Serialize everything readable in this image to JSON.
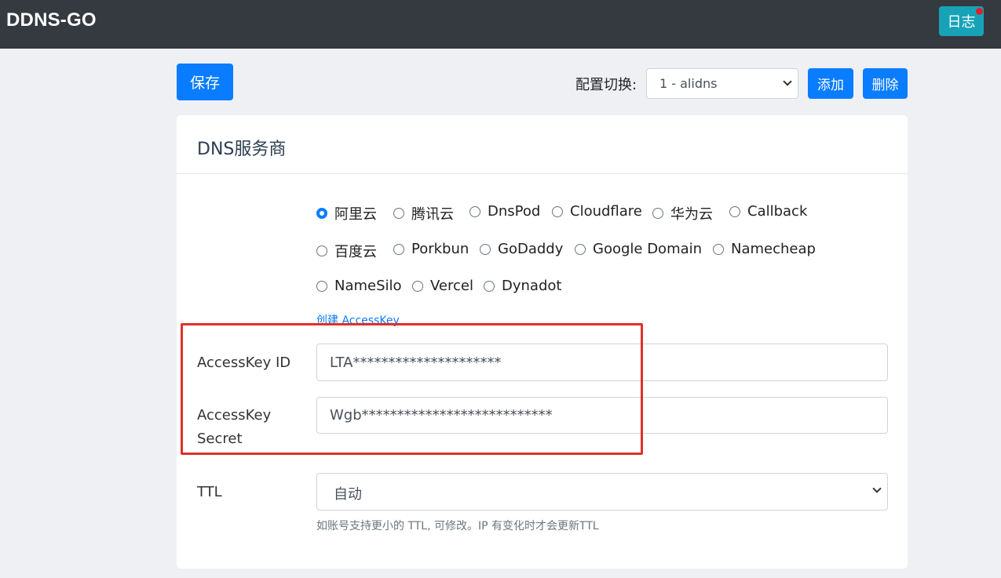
{
  "navbar": {
    "brand": "DDNS-GO",
    "log_button": "日志"
  },
  "toolbar": {
    "save_label": "保存",
    "config_switch_label": "配置切换:",
    "config_selected": "1 - alidns",
    "add_label": "添加",
    "delete_label": "删除"
  },
  "card": {
    "title": "DNS服务商",
    "providers": [
      "阿里云",
      "腾讯云",
      "DnsPod",
      "Cloudflare",
      "华为云",
      "Callback",
      "百度云",
      "Porkbun",
      "GoDaddy",
      "Google Domain",
      "Namecheap",
      "NameSilo",
      "Vercel",
      "Dynadot"
    ],
    "selected_provider": "阿里云",
    "create_link": "创建 AccessKey",
    "access_key_id_label": "AccessKey ID",
    "access_key_id_value": "LTA*********************",
    "access_key_secret_label_1": "AccessKey",
    "access_key_secret_label_2": "Secret",
    "access_key_secret_value": "Wgb***************************",
    "ttl_label": "TTL",
    "ttl_selected": "自动",
    "ttl_hint": "如账号支持更小的 TTL, 可修改。IP 有变化时才会更新TTL"
  },
  "colors": {
    "navbar": "#343a40",
    "primary": "#0a7cff",
    "log_button": "#17a2b8",
    "highlight_box": "#e0302a"
  }
}
